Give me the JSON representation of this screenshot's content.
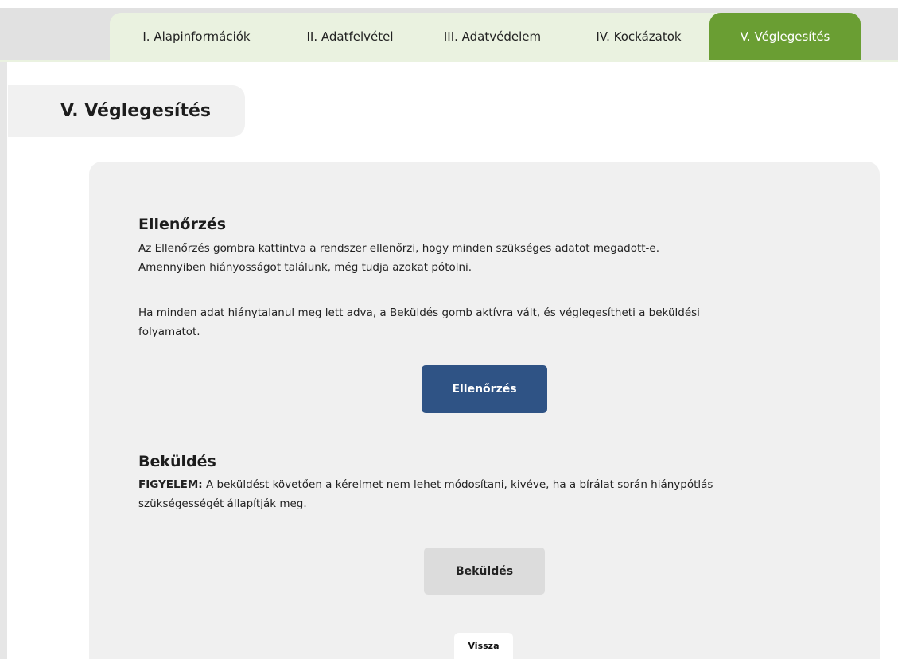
{
  "tabs": [
    {
      "label": "I. Alapinformációk",
      "active": false
    },
    {
      "label": "II. Adatfelvétel",
      "active": false
    },
    {
      "label": "III. Adatvédelem",
      "active": false
    },
    {
      "label": "IV. Kockázatok",
      "active": false
    },
    {
      "label": "V. Véglegesítés",
      "active": true
    }
  ],
  "page_title": "V. Véglegesítés",
  "check_section": {
    "title": "Ellenőrzés",
    "para1_line1": "Az Ellenőrzés gombra kattintva a rendszer ellenőrzi, hogy minden szükséges adatot megadott-e.",
    "para1_line2": "Amennyiben hiányosságot találunk, még tudja azokat pótolni.",
    "para2_line1": "Ha minden adat hiánytalanul meg lett adva, a Beküldés gomb aktívra vált, és véglegesítheti a beküldési",
    "para2_line2": "folyamatot.",
    "button_label": "Ellenőrzés"
  },
  "submit_section": {
    "title": "Beküldés",
    "warning_label": "FIGYELEM:",
    "warning_line1_rest": " A beküldést követően a kérelmet nem lehet módosítani, kivéve, ha a bírálat során hiánypótlás",
    "warning_line2": "szükségességét állapítják meg.",
    "button_label": "Beküldés"
  },
  "back_button_label": "Vissza",
  "colors": {
    "active_tab": "#6a9e33",
    "primary_button": "#2f5385",
    "disabled_button": "#dcdcdc"
  }
}
